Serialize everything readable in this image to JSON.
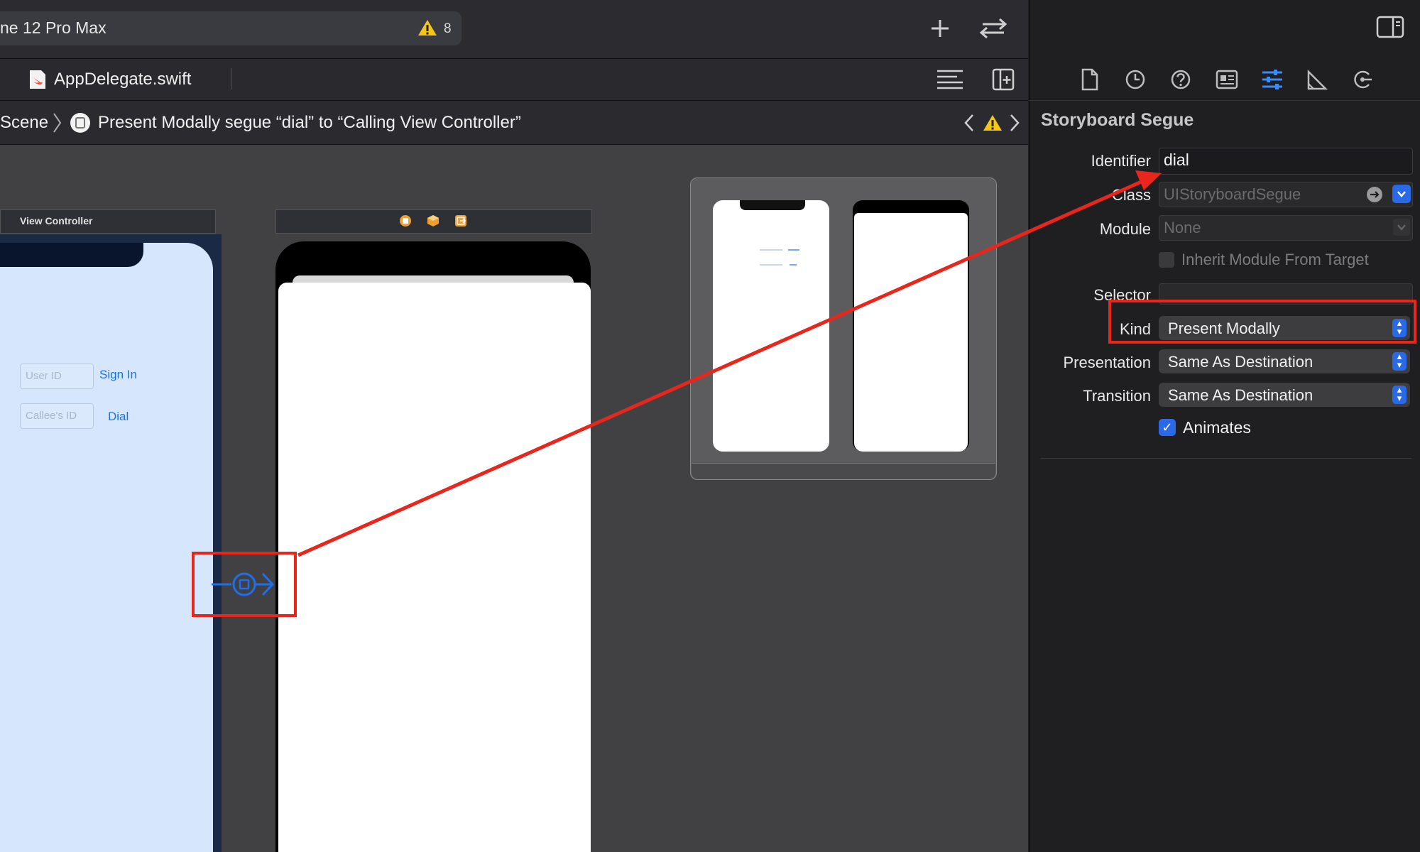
{
  "toolbar": {
    "scheme_label": "ne 12 Pro Max",
    "warning_count": "8"
  },
  "editor_tabs": [
    {
      "label": "AppDelegate.swift",
      "icon": "swift-file-icon"
    }
  ],
  "jump_bar": {
    "crumb_scene": "Scene",
    "crumb_segue": "Present Modally segue “dial” to “Calling View Controller”"
  },
  "canvas": {
    "view_controller_title": "View Controller",
    "user_id_placeholder": "User ID",
    "sign_in_label": "Sign In",
    "callee_id_placeholder": "Callee's ID",
    "dial_label": "Dial"
  },
  "inspector": {
    "heading": "Storyboard Segue",
    "identifier_label": "Identifier",
    "identifier_value": "dial",
    "class_label": "Class",
    "class_placeholder": "UIStoryboardSegue",
    "module_label": "Module",
    "module_placeholder": "None",
    "inherit_label": "Inherit Module From Target",
    "selector_label": "Selector",
    "kind_label": "Kind",
    "kind_value": "Present Modally",
    "presentation_label": "Presentation",
    "presentation_value": "Same As Destination",
    "transition_label": "Transition",
    "transition_value": "Same As Destination",
    "animates_label": "Animates",
    "animates_checked": true,
    "tabs": [
      "file-icon",
      "history-icon",
      "help-icon",
      "identity-icon",
      "attributes-icon",
      "size-icon",
      "connections-icon"
    ]
  },
  "colors": {
    "accent": "#2b6ae6",
    "annotation": "#e8261b",
    "warning": "#f5c518"
  }
}
